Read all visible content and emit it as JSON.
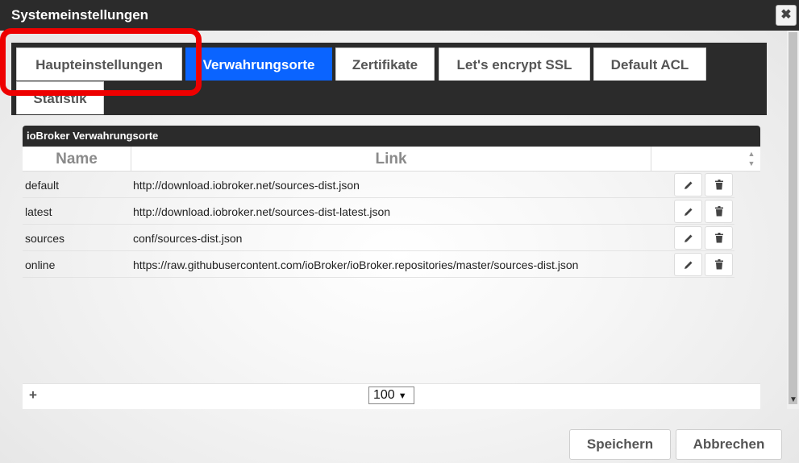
{
  "window": {
    "title": "Systemeinstellungen",
    "close_label": "✖"
  },
  "tabs": [
    {
      "label": "Haupteinstellungen",
      "active": false
    },
    {
      "label": "Verwahrungsorte",
      "active": true
    },
    {
      "label": "Zertifikate",
      "active": false
    },
    {
      "label": "Let's encrypt SSL",
      "active": false
    },
    {
      "label": "Default ACL",
      "active": false
    },
    {
      "label": "Statistik",
      "active": false
    }
  ],
  "panel": {
    "title": "ioBroker Verwahrungsorte",
    "columns": [
      "Name",
      "Link"
    ],
    "rows": [
      {
        "name": "default",
        "link": "http://download.iobroker.net/sources-dist.json"
      },
      {
        "name": "latest",
        "link": "http://download.iobroker.net/sources-dist-latest.json"
      },
      {
        "name": "sources",
        "link": "conf/sources-dist.json"
      },
      {
        "name": "online",
        "link": "https://raw.githubusercontent.com/ioBroker/ioBroker.repositories/master/sources-dist.json"
      }
    ],
    "add_label": "+",
    "page_size": "100"
  },
  "buttons": {
    "save": "Speichern",
    "cancel": "Abbrechen"
  },
  "colors": {
    "accent": "#0a64ff",
    "highlight": "#ee0000",
    "dark": "#2b2b2b"
  },
  "icons": {
    "edit": "pencil-icon",
    "delete": "trash-icon"
  }
}
